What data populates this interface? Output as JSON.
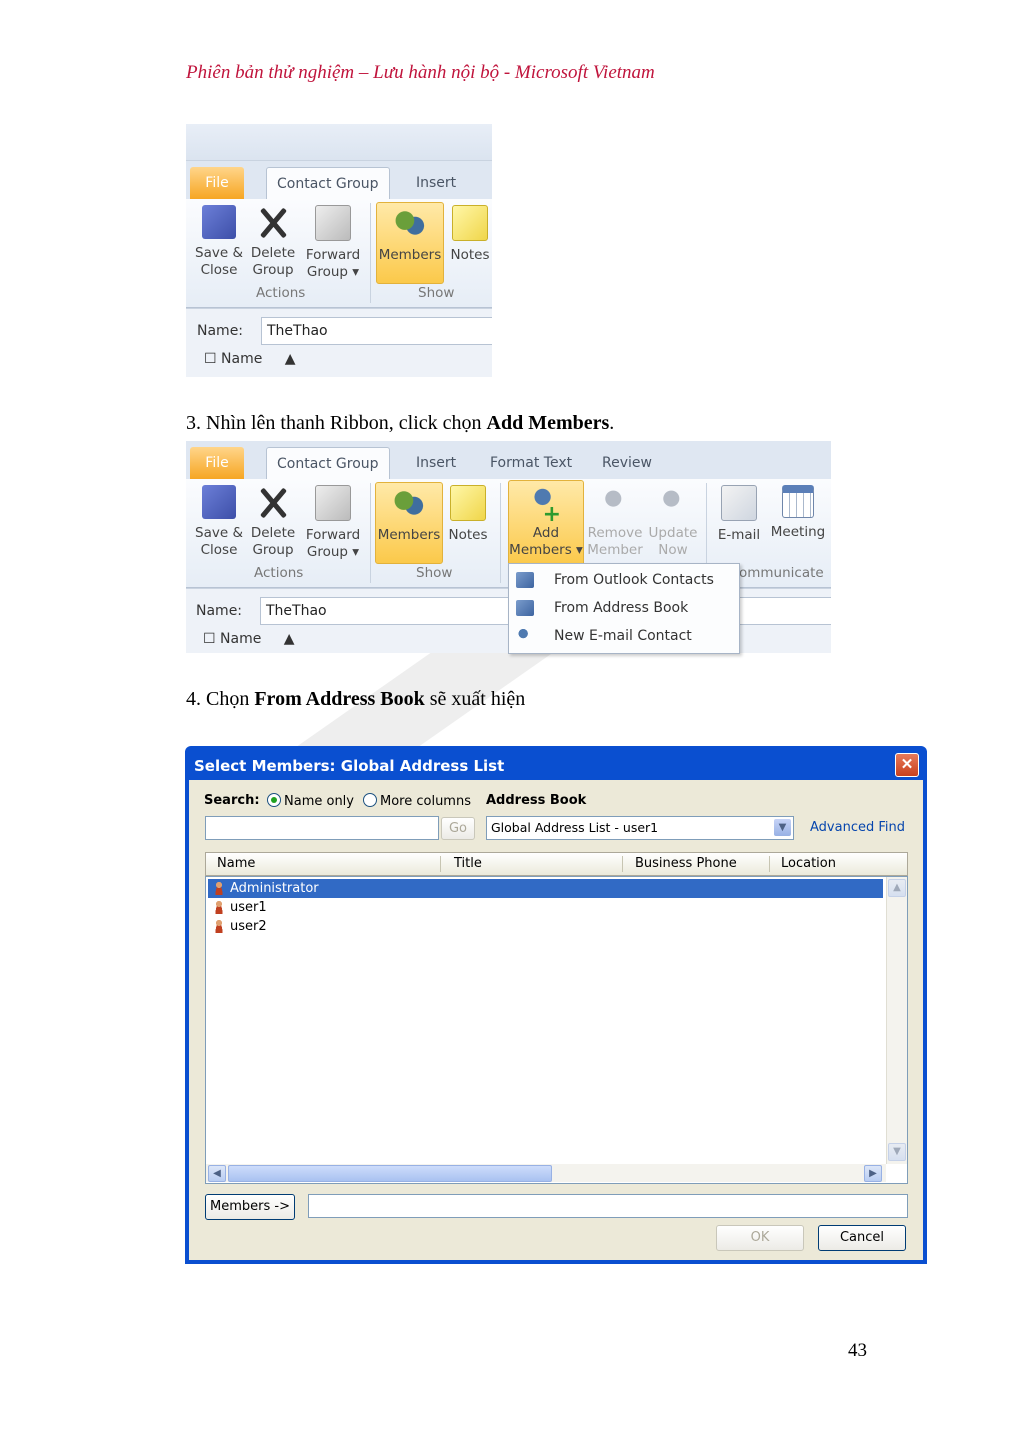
{
  "header": {
    "text": "Phiên bản thử nghiệm – Lưu hành nội bộ - Microsoft Vietnam"
  },
  "ribbon1": {
    "tabs": [
      "File",
      "Contact Group",
      "Insert"
    ],
    "buttons": {
      "save_l1": "Save &",
      "save_l2": "Close",
      "delete_l1": "Delete",
      "delete_l2": "Group",
      "forward_l1": "Forward",
      "forward_l2": "Group ▾",
      "members": "Members",
      "notes": "Notes"
    },
    "groups": {
      "actions": "Actions",
      "show": "Show"
    },
    "name_label": "Name:",
    "name_value": "TheThao",
    "col_name": "Name"
  },
  "step3": {
    "prefix": "3. Nhìn lên thanh Ribbon, click chọn ",
    "bold": "Add Members",
    "suffix": "."
  },
  "ribbon2": {
    "tabs": [
      "File",
      "Contact Group",
      "Insert",
      "Format Text",
      "Review"
    ],
    "buttons": {
      "save_l1": "Save &",
      "save_l2": "Close",
      "delete_l1": "Delete",
      "delete_l2": "Group",
      "forward_l1": "Forward",
      "forward_l2": "Group ▾",
      "members": "Members",
      "notes": "Notes",
      "add_l1": "Add",
      "add_l2": "Members ▾",
      "remove_l1": "Remove",
      "remove_l2": "Member",
      "update_l1": "Update",
      "update_l2": "Now",
      "email": "E-mail",
      "meeting": "Meeting"
    },
    "groups": {
      "actions": "Actions",
      "show": "Show",
      "communicate": "ommunicate"
    },
    "menu": [
      "From Outlook Contacts",
      "From Address Book",
      "New E-mail Contact"
    ],
    "name_label": "Name:",
    "name_value": "TheThao",
    "col_name": "Name"
  },
  "step4": {
    "prefix": "4. Chọn ",
    "bold": "From Address Book",
    "suffix": " sẽ xuất hiện"
  },
  "dialog": {
    "title": "Select Members: Global Address List",
    "close": "✕",
    "search_label": "Search:",
    "radio_name_only": "Name only",
    "radio_more_columns": "More columns",
    "address_book_label": "Address Book",
    "search_value": "",
    "go": "Go",
    "address_book_value": "Global Address List - user1",
    "advanced_find": "Advanced Find",
    "columns": [
      "Name",
      "Title",
      "Business Phone",
      "Location"
    ],
    "rows": [
      "Administrator",
      "user1",
      "user2"
    ],
    "members_btn": "Members ->",
    "members_value": "",
    "ok": "OK",
    "cancel": "Cancel"
  },
  "page_number": "43"
}
